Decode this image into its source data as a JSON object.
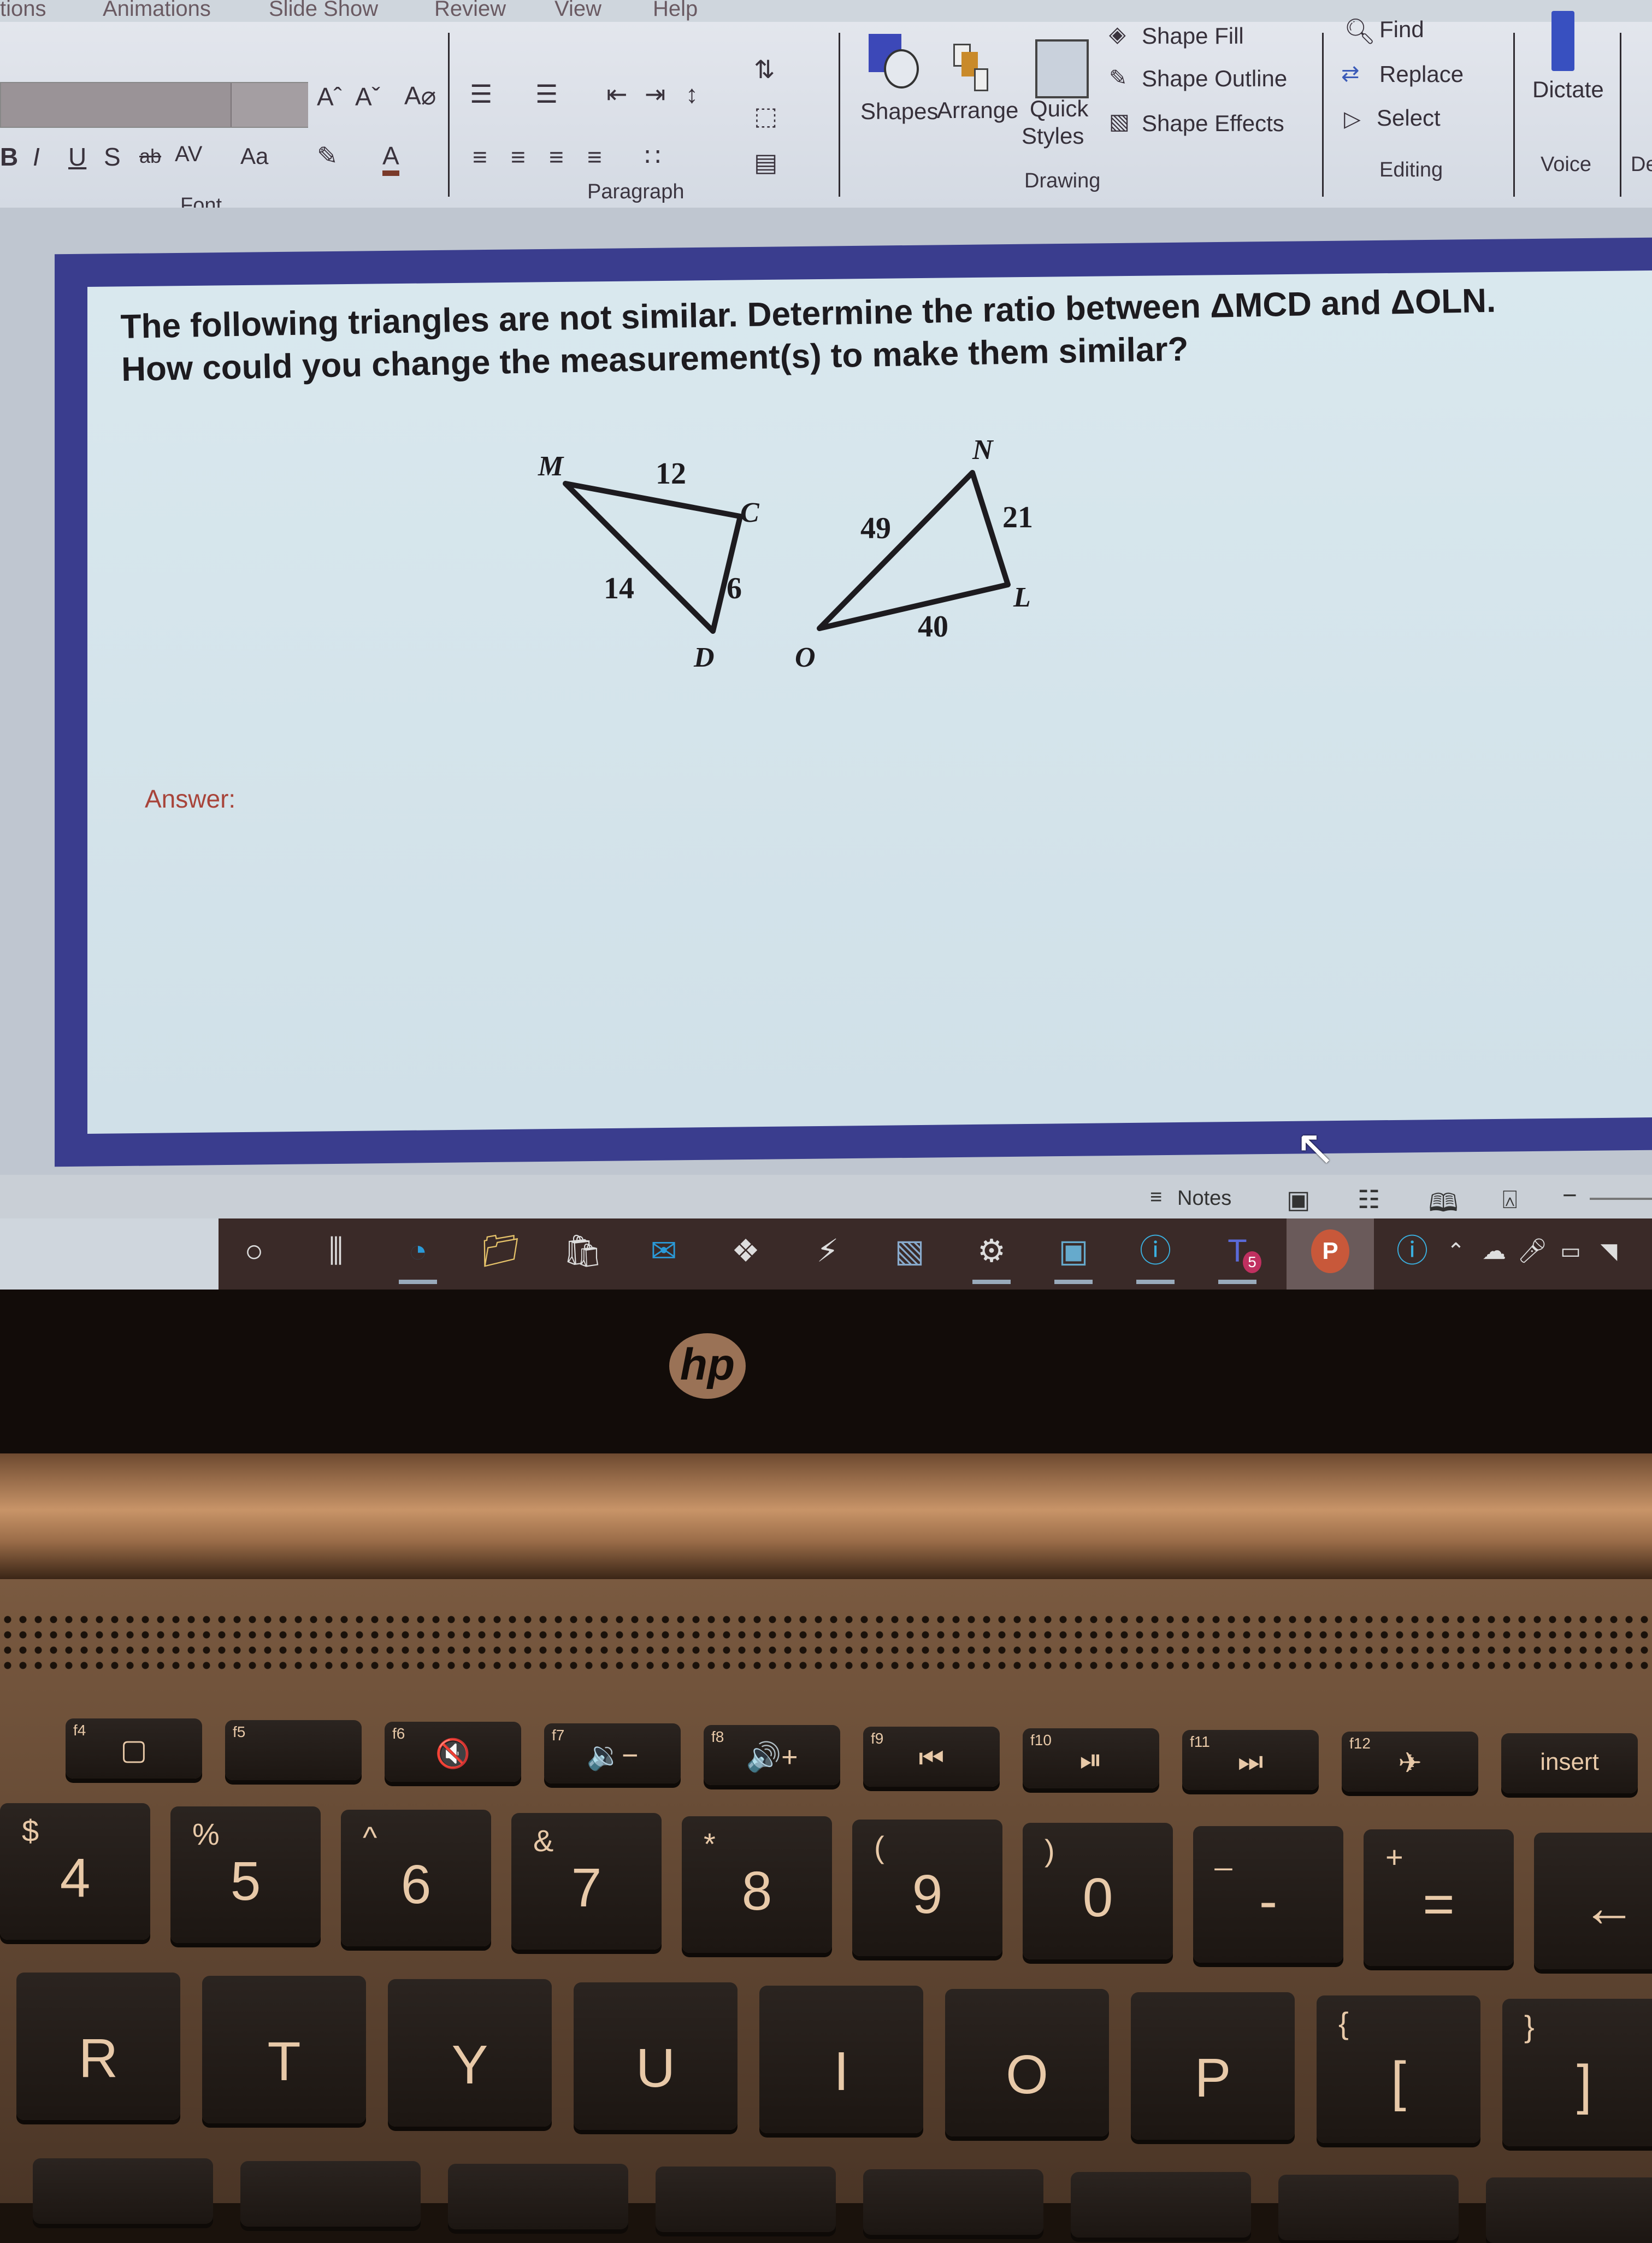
{
  "ribbon": {
    "tabs": [
      "tions",
      "Animations",
      "Slide Show",
      "Review",
      "View",
      "Help"
    ],
    "groups": {
      "font": {
        "label": "Font",
        "buttons": [
          "Increase Font Size",
          "Decrease Font Size",
          "Clear Formatting",
          "Bold",
          "Italic",
          "Underline",
          "Shadow",
          "Strikethrough",
          "Character Spacing",
          "Change Case",
          "Highlight Color",
          "Font Color"
        ],
        "glyphs": {
          "grow": "Aˆ",
          "shrink": "Aˇ",
          "bold": "B",
          "italic": "I",
          "underline": "U",
          "shadow": "S",
          "strike": "ab",
          "spacing": "AV",
          "case": "Aa",
          "color": "A"
        }
      },
      "paragraph": {
        "label": "Paragraph"
      },
      "drawing": {
        "label": "Drawing",
        "shapes": "Shapes",
        "arrange": "Arrange",
        "quick_styles_1": "Quick",
        "quick_styles_2": "Styles",
        "shape_fill": "Shape Fill",
        "shape_outline": "Shape Outline",
        "shape_effects": "Shape Effects"
      },
      "editing": {
        "label": "Editing",
        "find": "Find",
        "replace": "Replace",
        "select": "Select"
      },
      "voice": {
        "label": "Voice",
        "dictate": "Dictate"
      },
      "next_partial": "De"
    }
  },
  "slide": {
    "question": "The following triangles are not similar. Determine the ratio between ΔMCD and ΔOLN. How could you change the measurement(s) to make them similar?",
    "answer_label": "Answer:",
    "answer_color": "#a8443a",
    "frame_color": "#3a3d8e",
    "triangle_mcd": {
      "vertices": [
        "M",
        "C",
        "D"
      ],
      "sides": {
        "MC": "12",
        "MD": "14",
        "CD": "6"
      }
    },
    "triangle_oln": {
      "vertices": [
        "O",
        "L",
        "N"
      ],
      "sides": {
        "ON": "49",
        "NL": "21",
        "OL": "40"
      }
    }
  },
  "statusbar": {
    "notes_label": "Notes",
    "view_buttons": [
      "Normal",
      "Slide Sorter",
      "Reading View",
      "Slide Show"
    ]
  },
  "taskbar": {
    "icons": [
      "search-circle",
      "task-view",
      "edge",
      "file-explorer",
      "store",
      "mail",
      "dropbox",
      "power-automate",
      "photos",
      "settings",
      "remote",
      "help",
      "teams",
      "powerpoint",
      "help-tray"
    ],
    "teams_badge": "5",
    "powerpoint_letter": "P"
  },
  "laptop": {
    "brand": "hp",
    "fkeys": [
      {
        "fn": "f4",
        "glyph": "▢"
      },
      {
        "fn": "f5",
        "glyph": ""
      },
      {
        "fn": "f6",
        "glyph": "🔇"
      },
      {
        "fn": "f7",
        "glyph": "🔉−"
      },
      {
        "fn": "f8",
        "glyph": "🔊+"
      },
      {
        "fn": "f9",
        "glyph": "⏮"
      },
      {
        "fn": "f10",
        "glyph": "⏯"
      },
      {
        "fn": "f11",
        "glyph": "⏭"
      },
      {
        "fn": "f12",
        "glyph": "✈"
      },
      {
        "fn": "",
        "glyph": "insert"
      }
    ],
    "number_keys": [
      {
        "top": "$",
        "main": "4"
      },
      {
        "top": "%",
        "main": "5"
      },
      {
        "top": "^",
        "main": "6"
      },
      {
        "top": "&",
        "main": "7"
      },
      {
        "top": "*",
        "main": "8"
      },
      {
        "top": "(",
        "main": "9"
      },
      {
        "top": ")",
        "main": "0"
      },
      {
        "top": "_",
        "main": "-"
      },
      {
        "top": "+",
        "main": "="
      },
      {
        "top": "",
        "main": "←"
      }
    ],
    "letter_keys": [
      {
        "top": "",
        "main": "R"
      },
      {
        "top": "",
        "main": "T"
      },
      {
        "top": "",
        "main": "Y"
      },
      {
        "top": "",
        "main": "U"
      },
      {
        "top": "",
        "main": "I"
      },
      {
        "top": "",
        "main": "O"
      },
      {
        "top": "",
        "main": "P"
      },
      {
        "top": "{",
        "main": "["
      },
      {
        "top": "}",
        "main": "]"
      }
    ]
  }
}
